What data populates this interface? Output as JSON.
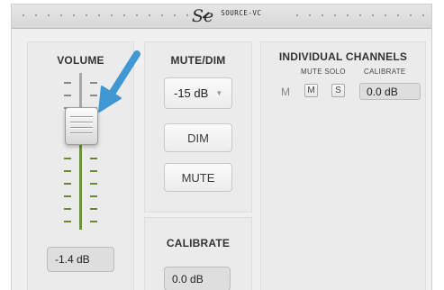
{
  "header": {
    "logo_mark": "Se",
    "logo_text": "SOURCE-VC"
  },
  "volume": {
    "title": "VOLUME",
    "value": "-1.4 dB"
  },
  "mute_dim": {
    "title": "MUTE/DIM",
    "dim_level": "-15 dB",
    "dim_label": "DIM",
    "mute_label": "MUTE"
  },
  "calibrate": {
    "title": "CALIBRATE",
    "value": "0.0 dB"
  },
  "channels": {
    "title": "INDIVIDUAL CHANNELS",
    "col_mute_solo": "MUTE SOLO",
    "col_calibrate": "CALIBRATE",
    "row_label": "M",
    "mute_button": "M",
    "solo_button": "S",
    "cal_value": "0.0 dB"
  },
  "icons": {
    "pointer_arrow": "arrow-icon",
    "dropdown_caret": "caret-down-icon"
  },
  "colors": {
    "level_green": "#6d9433",
    "arrow_blue": "#3f97d3"
  }
}
